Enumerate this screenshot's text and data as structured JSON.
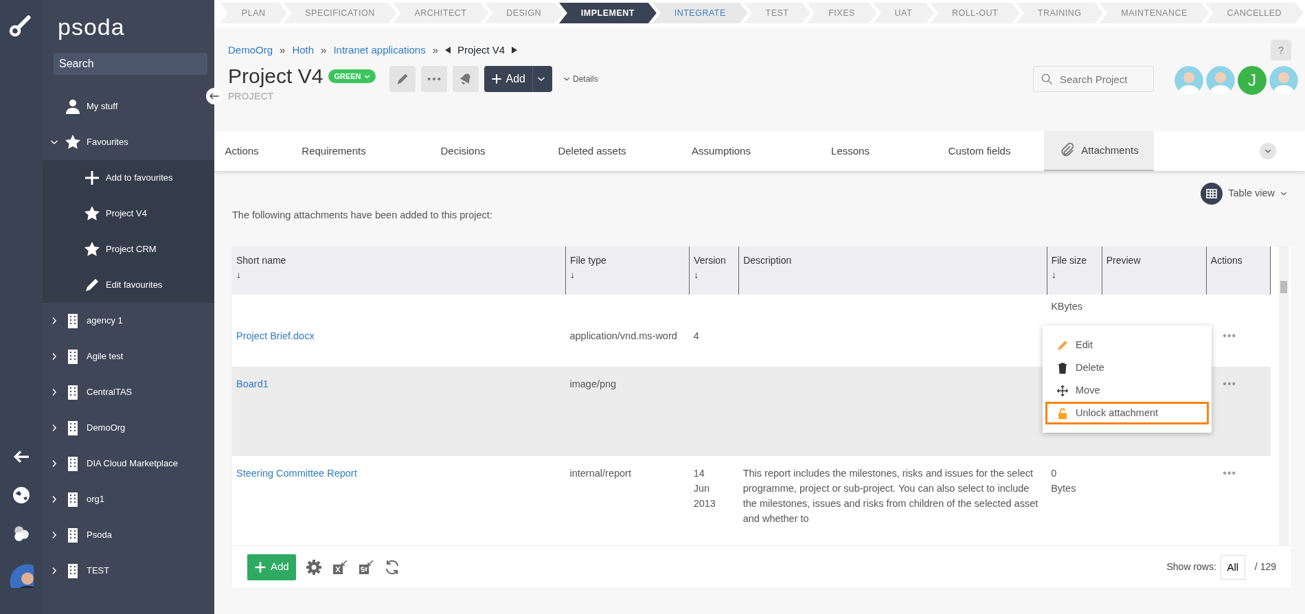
{
  "app": {
    "logo": "psoda",
    "search": {
      "placeholder": "Search"
    }
  },
  "sidebar": {
    "items": [
      {
        "label": "My stuff",
        "kind": "user"
      },
      {
        "label": "Favourites",
        "kind": "star",
        "expanded": true,
        "children": [
          {
            "label": "Add to favourites",
            "kind": "plus"
          },
          {
            "label": "Project V4",
            "kind": "star"
          },
          {
            "label": "Project CRM",
            "kind": "star"
          },
          {
            "label": "Edit favourites",
            "kind": "pencil"
          }
        ]
      },
      {
        "label": "agency 1",
        "kind": "org",
        "expanded": false
      },
      {
        "label": "Agile test",
        "kind": "org",
        "expanded": false
      },
      {
        "label": "CentralTAS",
        "kind": "org",
        "expanded": false
      },
      {
        "label": "DemoOrg",
        "kind": "org",
        "expanded": false
      },
      {
        "label": "DIA Cloud Marketplace",
        "kind": "org",
        "expanded": false
      },
      {
        "label": "org1",
        "kind": "org",
        "expanded": false
      },
      {
        "label": "Psoda",
        "kind": "org",
        "expanded": false
      },
      {
        "label": "TEST",
        "kind": "org",
        "expanded": false
      }
    ]
  },
  "stages": [
    {
      "label": "PLAN",
      "selected": false,
      "upcoming": false
    },
    {
      "label": "SPECIFICATION",
      "selected": false,
      "upcoming": false
    },
    {
      "label": "ARCHITECT",
      "selected": false,
      "upcoming": false
    },
    {
      "label": "DESIGN",
      "selected": false,
      "upcoming": false
    },
    {
      "label": "IMPLEMENT",
      "selected": true,
      "upcoming": false
    },
    {
      "label": "INTEGRATE",
      "selected": false,
      "upcoming": true
    },
    {
      "label": "TEST",
      "selected": false,
      "upcoming": false
    },
    {
      "label": "FIXES",
      "selected": false,
      "upcoming": false
    },
    {
      "label": "UAT",
      "selected": false,
      "upcoming": false
    },
    {
      "label": "ROLL-OUT",
      "selected": false,
      "upcoming": false
    },
    {
      "label": "TRAINING",
      "selected": false,
      "upcoming": false
    },
    {
      "label": "MAINTENANCE",
      "selected": false,
      "upcoming": false
    },
    {
      "label": "CANCELLED",
      "selected": false,
      "upcoming": false
    }
  ],
  "breadcrumb": [
    "DemoOrg",
    "Hoth",
    "Intranet applications"
  ],
  "breadcrumb_separator": "»",
  "breadcrumb_current": "Project V4",
  "help": "?",
  "project": {
    "title": "Project V4",
    "status_badge": {
      "label": "GREEN",
      "color": "#3cc55e"
    },
    "type": "PROJECT",
    "add_button": "Add",
    "details": "Details",
    "search": {
      "placeholder": "Search Project"
    }
  },
  "members": [
    {
      "kind": "photo",
      "color": "#8fd3e8"
    },
    {
      "kind": "photo",
      "color": "#8fd3e8"
    },
    {
      "kind": "letter",
      "letter": "J",
      "color": "#3bb54a"
    },
    {
      "kind": "photo",
      "color": "#8fd3e8"
    }
  ],
  "tabs": [
    {
      "label": "Actions",
      "selected": false
    },
    {
      "label": "Requirements",
      "selected": false
    },
    {
      "label": "Decisions",
      "selected": false
    },
    {
      "label": "Deleted assets",
      "selected": false
    },
    {
      "label": "Assumptions",
      "selected": false
    },
    {
      "label": "Lessons",
      "selected": false
    },
    {
      "label": "Custom fields",
      "selected": false
    },
    {
      "label": "Attachments",
      "selected": true
    }
  ],
  "view_switch": "Table view",
  "intro": "The following attachments have been added to this project:",
  "table": {
    "columns": [
      {
        "label": "Short name",
        "sortable": true
      },
      {
        "label": "File type",
        "sortable": true
      },
      {
        "label": "Version",
        "sortable": true
      },
      {
        "label": "Description",
        "sortable": false
      },
      {
        "label": "File size",
        "sortable": true
      },
      {
        "label": "Preview",
        "sortable": false
      },
      {
        "label": "Actions",
        "sortable": false
      }
    ],
    "sort_mark": "↓",
    "rows": [
      {
        "name": "",
        "file_type": "",
        "version": "",
        "description": "",
        "file_size": "KBytes",
        "selected": false
      },
      {
        "name": "Project Brief.docx",
        "file_type": "application/vnd.ms-word",
        "version": "4",
        "description": "",
        "file_size": "",
        "selected": false,
        "actions": "•••"
      },
      {
        "name": "Board1",
        "file_type": "image/png",
        "version": "",
        "description": "",
        "file_size": "",
        "selected": true,
        "actions": "•••"
      },
      {
        "name": "Steering Committee Report",
        "file_type": "internal/report",
        "version": "14 Jun 2013",
        "description": "This report includes the milestones, risks and issues for the select programme, project or sub-project. You can also select to include the milestones, issues and risks from children of the selected asset and whether to",
        "file_size": "0 Bytes",
        "selected": false,
        "actions": "•••"
      }
    ]
  },
  "context_menu": [
    {
      "label": "Edit",
      "kind": "edit",
      "highlighted": false
    },
    {
      "label": "Delete",
      "kind": "delete",
      "highlighted": false
    },
    {
      "label": "Move",
      "kind": "move",
      "highlighted": false
    },
    {
      "label": "Unlock attachment",
      "kind": "unlock",
      "highlighted": true
    }
  ],
  "footer": {
    "add_button": "Add",
    "show_rows_label": "Show rows:",
    "show_rows_value": "All",
    "total": "/ 129"
  }
}
